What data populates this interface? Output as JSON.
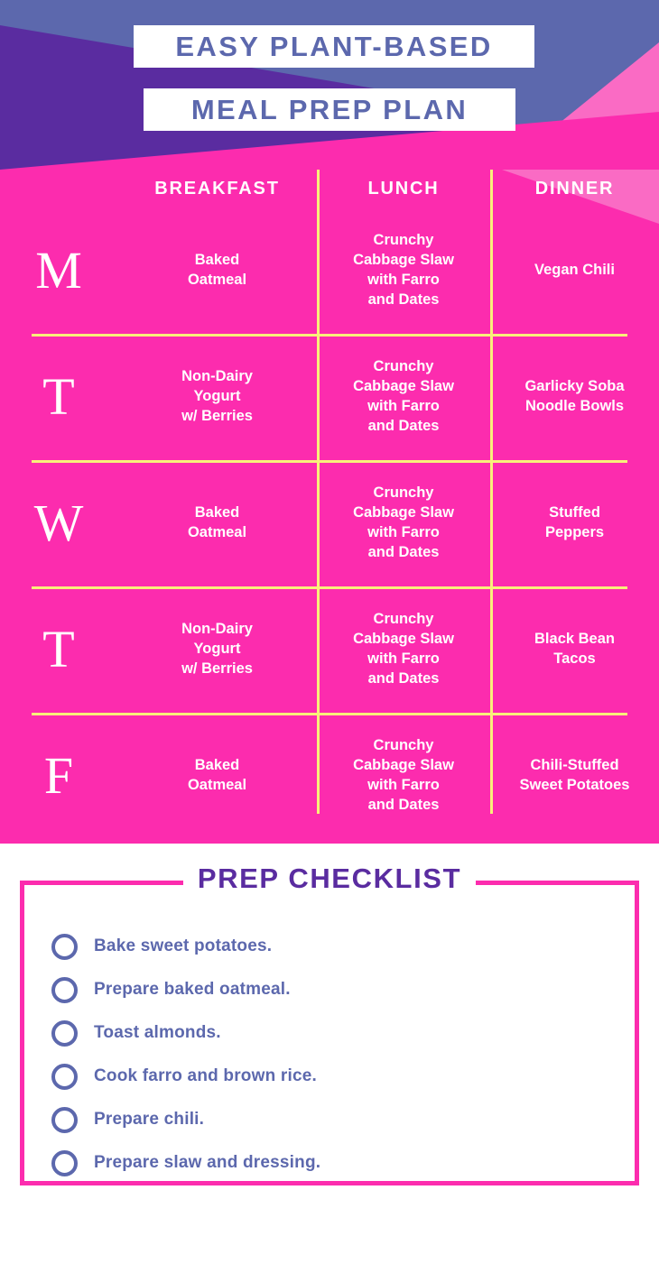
{
  "colors": {
    "periwinkle": "#5c68ad",
    "deep_purple": "#5a2ca0",
    "hot_pink": "#fc2cae",
    "light_pink": "#fa6bc4",
    "yellow": "#f9f07a",
    "white": "#ffffff"
  },
  "header": {
    "title_line_1": "EASY PLANT-BASED",
    "title_line_2": "MEAL PREP PLAN"
  },
  "table": {
    "columns": [
      "",
      "BREAKFAST",
      "LUNCH",
      "DINNER"
    ],
    "rows": [
      {
        "day": "M",
        "breakfast": "Baked\nOatmeal",
        "lunch": "Crunchy\nCabbage Slaw\nwith Farro\nand Dates",
        "dinner": "Vegan Chili"
      },
      {
        "day": "T",
        "breakfast": "Non-Dairy\nYogurt\nw/ Berries",
        "lunch": "Crunchy\nCabbage Slaw\nwith Farro\nand Dates",
        "dinner": "Garlicky Soba\nNoodle Bowls"
      },
      {
        "day": "W",
        "breakfast": "Baked\nOatmeal",
        "lunch": "Crunchy\nCabbage Slaw\nwith Farro\nand Dates",
        "dinner": "Stuffed\nPeppers"
      },
      {
        "day": "T",
        "breakfast": "Non-Dairy\nYogurt\nw/ Berries",
        "lunch": "Crunchy\nCabbage Slaw\nwith Farro\nand Dates",
        "dinner": "Black Bean\nTacos"
      },
      {
        "day": "F",
        "breakfast": "Baked\nOatmeal",
        "lunch": "Crunchy\nCabbage Slaw\nwith Farro\nand Dates",
        "dinner": "Chili-Stuffed\nSweet Potatoes"
      }
    ]
  },
  "checklist": {
    "title": "PREP CHECKLIST",
    "items": [
      {
        "label": "Bake sweet potatoes.",
        "checked": false
      },
      {
        "label": "Prepare baked oatmeal.",
        "checked": false
      },
      {
        "label": "Toast almonds.",
        "checked": false
      },
      {
        "label": "Cook farro and brown rice.",
        "checked": false
      },
      {
        "label": "Prepare chili.",
        "checked": false
      },
      {
        "label": "Prepare slaw and dressing.",
        "checked": false
      }
    ]
  }
}
